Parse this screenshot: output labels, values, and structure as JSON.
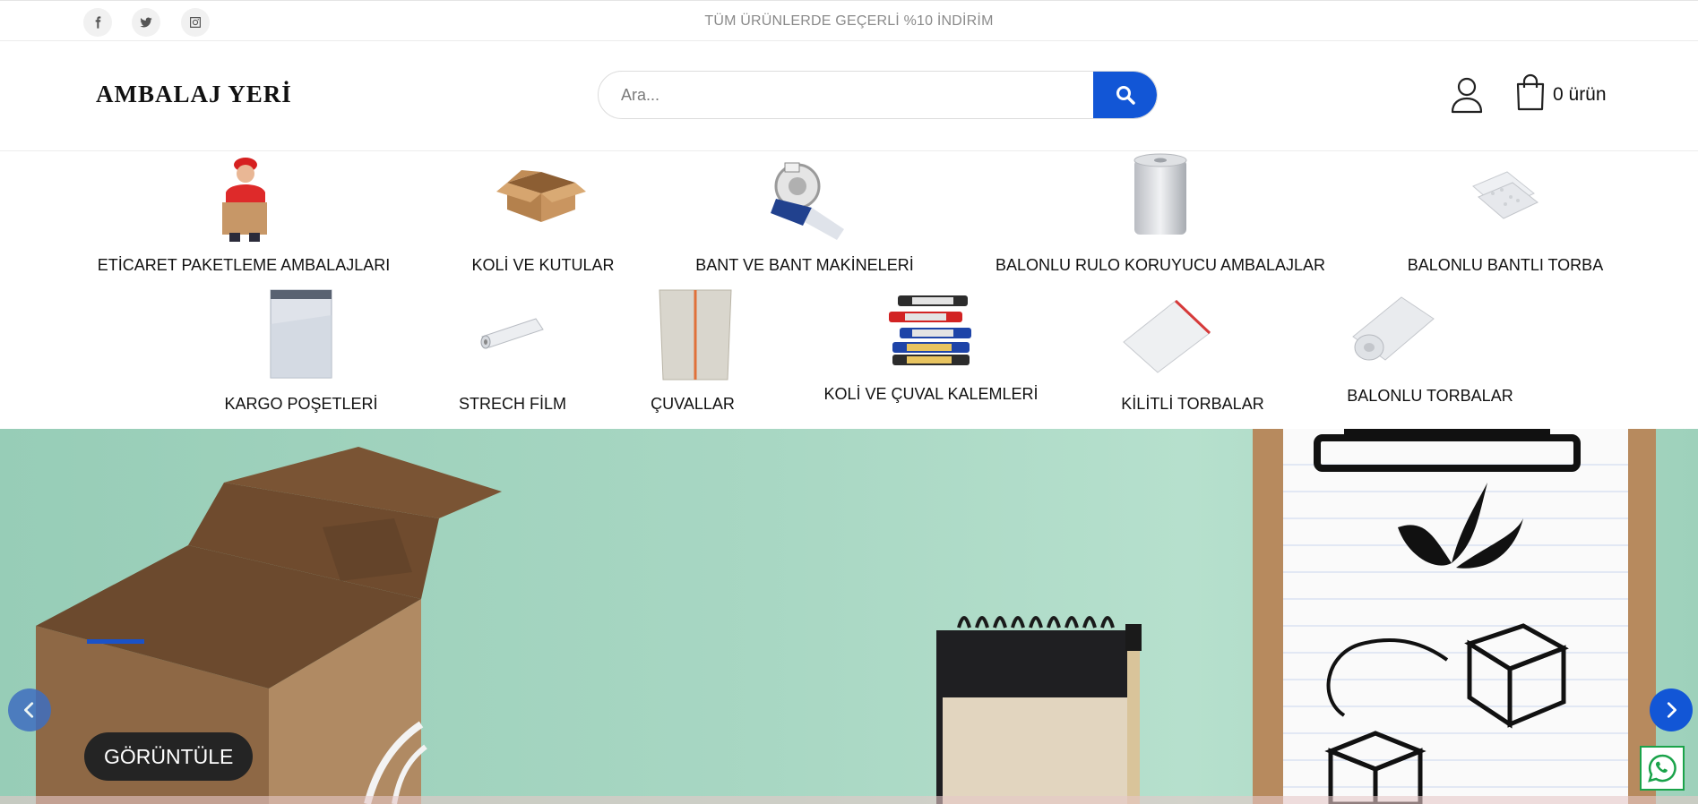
{
  "topbar": {
    "announcement": "TÜM ÜRÜNLERDE GEÇERLİ %10 İNDİRİM",
    "social": [
      "facebook-icon",
      "twitter-icon",
      "instagram-icon"
    ]
  },
  "header": {
    "logo": "AMBALAJ YERİ",
    "search_placeholder": "Ara...",
    "cart_label": "0 ürün"
  },
  "categories": [
    {
      "label": "ETİCARET PAKETLEME AMBALAJLARI",
      "image": "delivery-woman-box"
    },
    {
      "label": "KOLİ VE KUTULAR",
      "image": "cardboard-box"
    },
    {
      "label": "BANT VE BANT MAKİNELERİ",
      "image": "tape-dispenser"
    },
    {
      "label": "BALONLU RULO KORUYUCU AMBALAJLAR",
      "image": "bubble-roll"
    },
    {
      "label": "BALONLU BANTLI TORBA",
      "image": "bubble-bags"
    },
    {
      "label": "KARGO POŞETLERİ",
      "image": "cargo-bag"
    },
    {
      "label": "STRECH FİLM",
      "image": "stretch-film"
    },
    {
      "label": "ÇUVALLAR",
      "image": "sack"
    },
    {
      "label": "KOLİ VE ÇUVAL KALEMLERİ",
      "image": "markers"
    },
    {
      "label": "KİLİTLİ TORBALAR",
      "image": "zip-bag"
    },
    {
      "label": "BALONLU TORBALAR",
      "image": "bubble-roll-small"
    }
  ],
  "hero": {
    "button_label": "GÖRÜNTÜLE"
  },
  "colors": {
    "accent": "#1256d6",
    "hero_bg": "#a8d7c3",
    "whatsapp": "#1aa34a"
  }
}
